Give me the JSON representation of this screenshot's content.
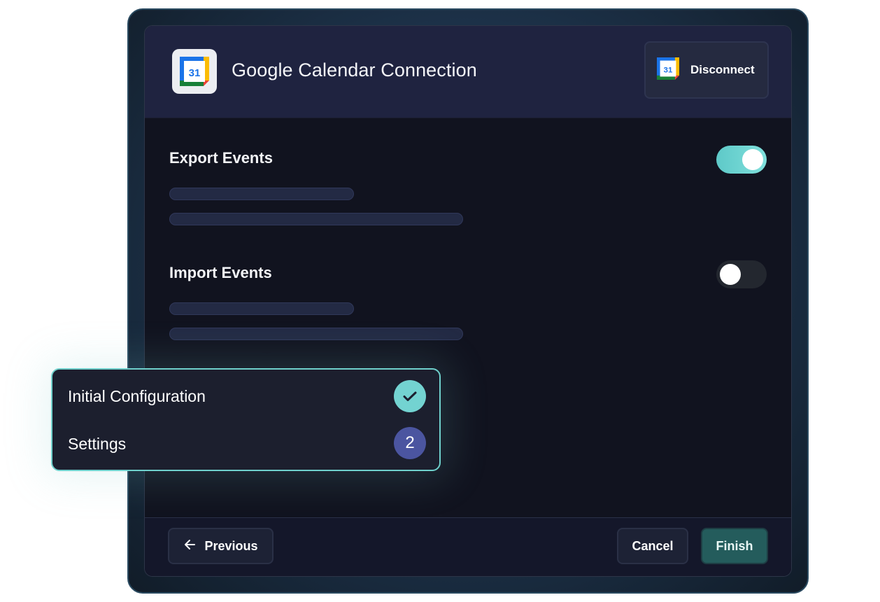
{
  "header": {
    "title": "Google Calendar Connection",
    "app_icon": "google-calendar-icon",
    "calendar_day": "31",
    "disconnect_label": "Disconnect"
  },
  "sections": [
    {
      "title": "Export Events",
      "enabled": true
    },
    {
      "title": "Import Events",
      "enabled": false
    }
  ],
  "footer": {
    "previous_label": "Previous",
    "cancel_label": "Cancel",
    "finish_label": "Finish"
  },
  "steps": [
    {
      "label": "Initial Configuration",
      "status": "complete"
    },
    {
      "label": "Settings",
      "number": "2",
      "status": "current"
    }
  ],
  "colors": {
    "accent": "#73d3d1",
    "step_current": "#4b55a0",
    "finish_button": "#245c5c",
    "header_bg": "#1f2340",
    "panel_bg": "#11131f"
  }
}
